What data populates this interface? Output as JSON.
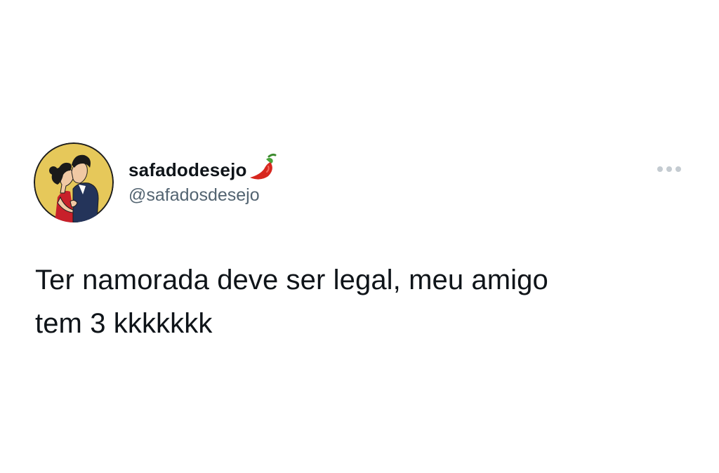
{
  "tweet": {
    "display_name": "safadodesejo",
    "handle": "@safadosdesejo",
    "name_emoji_icon": "hot-pepper-icon",
    "more_icon": "more-options-icon",
    "text_line_1": "Ter namorada deve ser legal, meu amigo",
    "text_line_2": "tem 3 kkkkkkk",
    "avatar_icon": "couple-kissing-avatar"
  },
  "colors": {
    "text_primary": "#0f1419",
    "text_secondary": "#536471",
    "avatar_background": "#e6c85a",
    "more_dots": "#c4cbd1",
    "pepper": "#d7261e"
  }
}
